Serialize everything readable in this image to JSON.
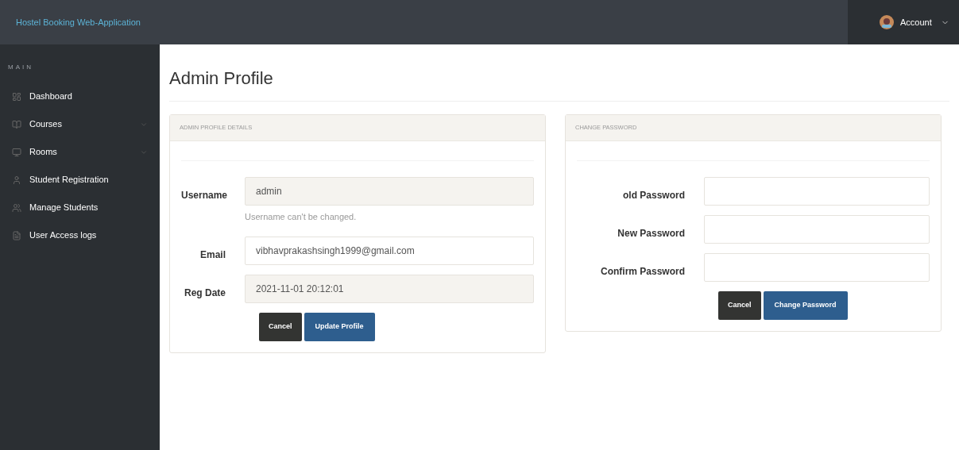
{
  "header": {
    "brand": "Hostel Booking Web-Application",
    "account": "Account"
  },
  "sidebar": {
    "section": "MAIN",
    "items": [
      {
        "label": "Dashboard",
        "expandable": false
      },
      {
        "label": "Courses",
        "expandable": true
      },
      {
        "label": "Rooms",
        "expandable": true
      },
      {
        "label": "Student Registration",
        "expandable": false
      },
      {
        "label": "Manage Students",
        "expandable": false
      },
      {
        "label": "User Access logs",
        "expandable": false
      }
    ]
  },
  "page_title": "Admin Profile",
  "panels": [
    {
      "title": "ADMIN PROFILE DETAILS",
      "fields": [
        {
          "label": "Username",
          "value": "admin",
          "disabled": true,
          "help": "Username can't be changed."
        },
        {
          "label": "Email",
          "value": "vibhavprakashsingh1999@gmail.com",
          "disabled": false
        },
        {
          "label": "Reg Date",
          "value": "2021-11-01 20:12:01",
          "disabled": true
        }
      ],
      "buttons": [
        {
          "label": "Cancel",
          "kind": "secondary"
        },
        {
          "label": "Update Profile",
          "kind": "primary"
        }
      ]
    },
    {
      "title": "CHANGE PASSWORD",
      "fields": [
        {
          "label": "old Password",
          "disabled": false
        },
        {
          "label": "New Password",
          "disabled": false
        },
        {
          "label": "Confirm Password",
          "disabled": false
        }
      ],
      "buttons": [
        {
          "label": "Cancel",
          "kind": "secondary"
        },
        {
          "label": "Change Password",
          "kind": "primary"
        }
      ]
    }
  ]
}
